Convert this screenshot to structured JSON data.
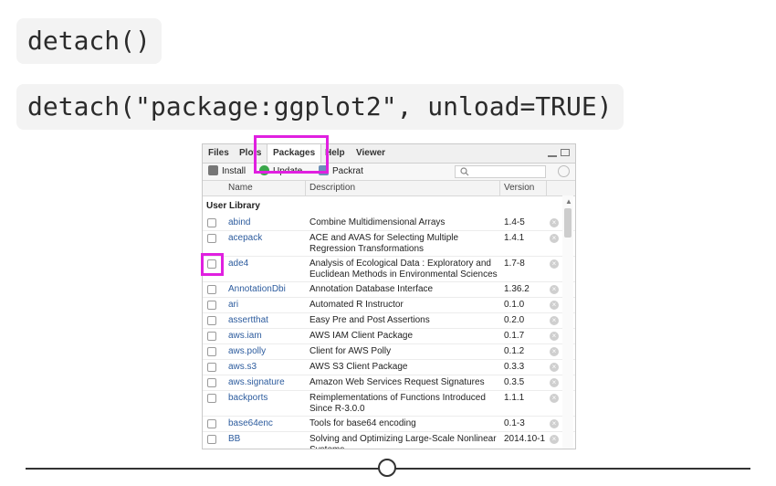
{
  "code": {
    "line1": "detach()",
    "line2": "detach(\"package:ggplot2\", unload=TRUE)"
  },
  "pane": {
    "tabs": [
      "Files",
      "Plots",
      "Packages",
      "Help",
      "Viewer"
    ],
    "toolbar": {
      "install": "Install",
      "update": "Update",
      "packrat": "Packrat"
    },
    "columns": {
      "name": "Name",
      "description": "Description",
      "version": "Version"
    },
    "section": "User Library",
    "packages": [
      {
        "name": "abind",
        "description": "Combine Multidimensional Arrays",
        "version": "1.4-5"
      },
      {
        "name": "acepack",
        "description": "ACE and AVAS for Selecting Multiple Regression Transformations",
        "version": "1.4.1"
      },
      {
        "name": "ade4",
        "description": "Analysis of Ecological Data : Exploratory and Euclidean Methods in Environmental Sciences",
        "version": "1.7-8"
      },
      {
        "name": "AnnotationDbi",
        "description": "Annotation Database Interface",
        "version": "1.36.2"
      },
      {
        "name": "ari",
        "description": "Automated R Instructor",
        "version": "0.1.0"
      },
      {
        "name": "assertthat",
        "description": "Easy Pre and Post Assertions",
        "version": "0.2.0"
      },
      {
        "name": "aws.iam",
        "description": "AWS IAM Client Package",
        "version": "0.1.7"
      },
      {
        "name": "aws.polly",
        "description": "Client for AWS Polly",
        "version": "0.1.2"
      },
      {
        "name": "aws.s3",
        "description": "AWS S3 Client Package",
        "version": "0.3.3"
      },
      {
        "name": "aws.signature",
        "description": "Amazon Web Services Request Signatures",
        "version": "0.3.5"
      },
      {
        "name": "backports",
        "description": "Reimplementations of Functions Introduced Since R-3.0.0",
        "version": "1.1.1"
      },
      {
        "name": "base64enc",
        "description": "Tools for base64 encoding",
        "version": "0.1-3"
      },
      {
        "name": "BB",
        "description": "Solving and Optimizing Large-Scale Nonlinear Systems",
        "version": "2014.10-1"
      }
    ]
  },
  "colors": {
    "highlight": "#e020e0",
    "package_link": "#2d5c9e"
  }
}
